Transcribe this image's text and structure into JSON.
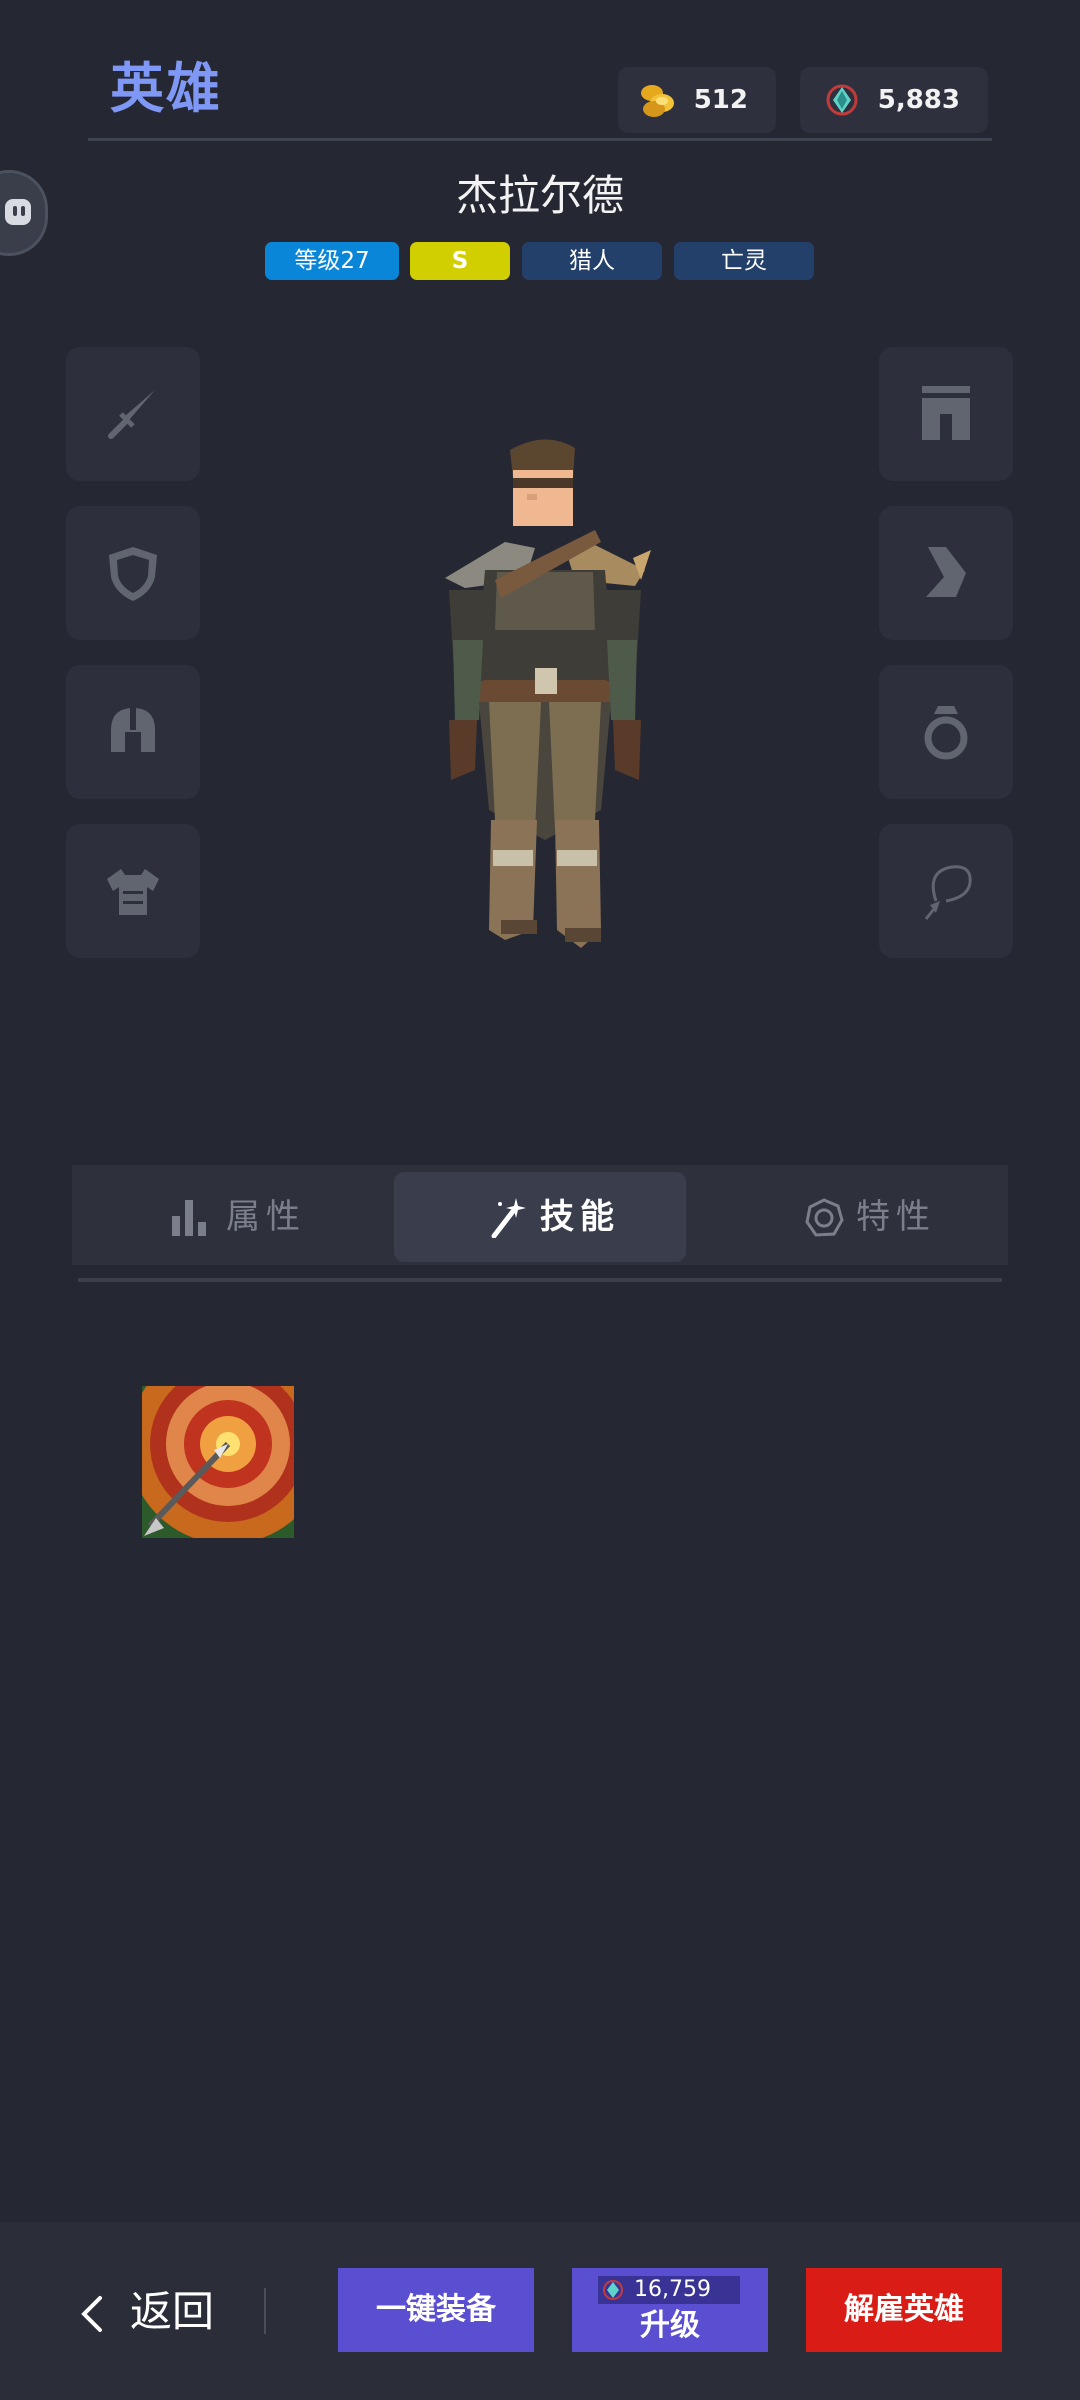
{
  "header": {
    "title": "英雄",
    "gold": "512",
    "gems": "5,883",
    "icons": {
      "gold": "gold-coins-icon",
      "gems": "gem-icon"
    }
  },
  "hero": {
    "name": "杰拉尔德",
    "tags": [
      {
        "label": "等级27",
        "color": "#0a86d8"
      },
      {
        "label": "S",
        "color": "#d2cf00"
      },
      {
        "label": "猎人",
        "color": "#23406b"
      },
      {
        "label": "亡灵",
        "color": "#23406b"
      }
    ]
  },
  "equipment": {
    "left_slots": [
      "sword-icon",
      "shield-icon",
      "helmet-icon",
      "chest-armor-icon"
    ],
    "right_slots": [
      "pants-icon",
      "boots-icon",
      "ring-icon",
      "necklace-icon"
    ]
  },
  "tabs": [
    {
      "label": "属性",
      "icon": "bar-chart-icon",
      "active": false
    },
    {
      "label": "技能",
      "icon": "magic-wand-icon",
      "active": true
    },
    {
      "label": "特性",
      "icon": "trait-icon",
      "active": false
    }
  ],
  "skills": [
    {
      "icon": "target-arrow-skill-icon"
    }
  ],
  "footer": {
    "back_label": "返回",
    "equip_all_label": "一键装备",
    "upgrade_cost": "16,759",
    "upgrade_label": "升级",
    "dismiss_label": "解雇英雄"
  },
  "colors": {
    "accent": "#7f97f5",
    "button_blue": "#5a4fd0",
    "button_red": "#d91c16",
    "background": "#252833"
  }
}
